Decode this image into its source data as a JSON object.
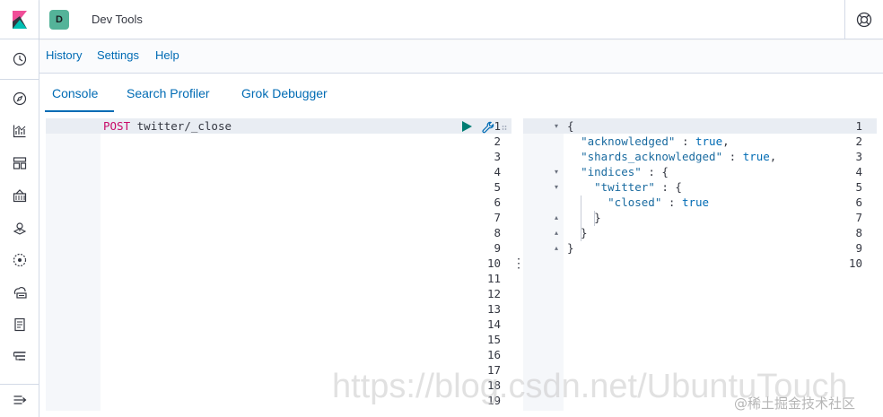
{
  "header": {
    "space_initial": "D",
    "title": "Dev Tools",
    "space_color": "#54b399"
  },
  "topmenu": {
    "items": [
      {
        "label": "History"
      },
      {
        "label": "Settings"
      },
      {
        "label": "Help"
      }
    ]
  },
  "tabs": [
    {
      "label": "Console",
      "active": true
    },
    {
      "label": "Search Profiler",
      "active": false
    },
    {
      "label": "Grok Debugger",
      "active": false
    }
  ],
  "rail": {
    "icons": [
      "kibana-logo-icon",
      "clock-recent-icon",
      "discover-compass-icon",
      "visualize-chart-icon",
      "dashboard-icon",
      "canvas-icon",
      "maps-icon",
      "ml-icon",
      "infrastructure-icon",
      "logs-icon",
      "apm-icon",
      "collapse-menu-icon"
    ]
  },
  "request_editor": {
    "line_numbers": [
      "1",
      "2",
      "3",
      "4",
      "5",
      "6",
      "7",
      "8",
      "9",
      "10",
      "11",
      "12",
      "13",
      "14",
      "15",
      "16",
      "17",
      "18",
      "19"
    ],
    "method": "POST",
    "url": "twitter/_close"
  },
  "response_editor": {
    "line_numbers": [
      "1",
      "2",
      "3",
      "4",
      "5",
      "6",
      "7",
      "8",
      "9",
      "10"
    ],
    "lines": [
      {
        "tokens": [
          {
            "t": "{",
            "c": "k-punct"
          }
        ]
      },
      {
        "tokens": [
          {
            "t": "  ",
            "c": "k-punct"
          },
          {
            "t": "\"acknowledged\"",
            "c": "k-str"
          },
          {
            "t": " : ",
            "c": "k-punct"
          },
          {
            "t": "true",
            "c": "k-bool"
          },
          {
            "t": ",",
            "c": "k-punct"
          }
        ]
      },
      {
        "tokens": [
          {
            "t": "  ",
            "c": "k-punct"
          },
          {
            "t": "\"shards_acknowledged\"",
            "c": "k-str"
          },
          {
            "t": " : ",
            "c": "k-punct"
          },
          {
            "t": "true",
            "c": "k-bool"
          },
          {
            "t": ",",
            "c": "k-punct"
          }
        ]
      },
      {
        "tokens": [
          {
            "t": "  ",
            "c": "k-punct"
          },
          {
            "t": "\"indices\"",
            "c": "k-str"
          },
          {
            "t": " : {",
            "c": "k-punct"
          }
        ]
      },
      {
        "tokens": [
          {
            "t": "    ",
            "c": "k-punct"
          },
          {
            "t": "\"twitter\"",
            "c": "k-str"
          },
          {
            "t": " : {",
            "c": "k-punct"
          }
        ]
      },
      {
        "tokens": [
          {
            "t": "      ",
            "c": "k-punct"
          },
          {
            "t": "\"closed\"",
            "c": "k-str"
          },
          {
            "t": " : ",
            "c": "k-punct"
          },
          {
            "t": "true",
            "c": "k-bool"
          }
        ]
      },
      {
        "tokens": [
          {
            "t": "    }",
            "c": "k-punct"
          }
        ]
      },
      {
        "tokens": [
          {
            "t": "  }",
            "c": "k-punct"
          }
        ]
      },
      {
        "tokens": [
          {
            "t": "}",
            "c": "k-punct"
          }
        ]
      },
      {
        "tokens": []
      }
    ]
  },
  "watermark": {
    "url": "https://blog.csdn.net/UbuntuTouch",
    "site": "@稀土掘金技术社区"
  }
}
